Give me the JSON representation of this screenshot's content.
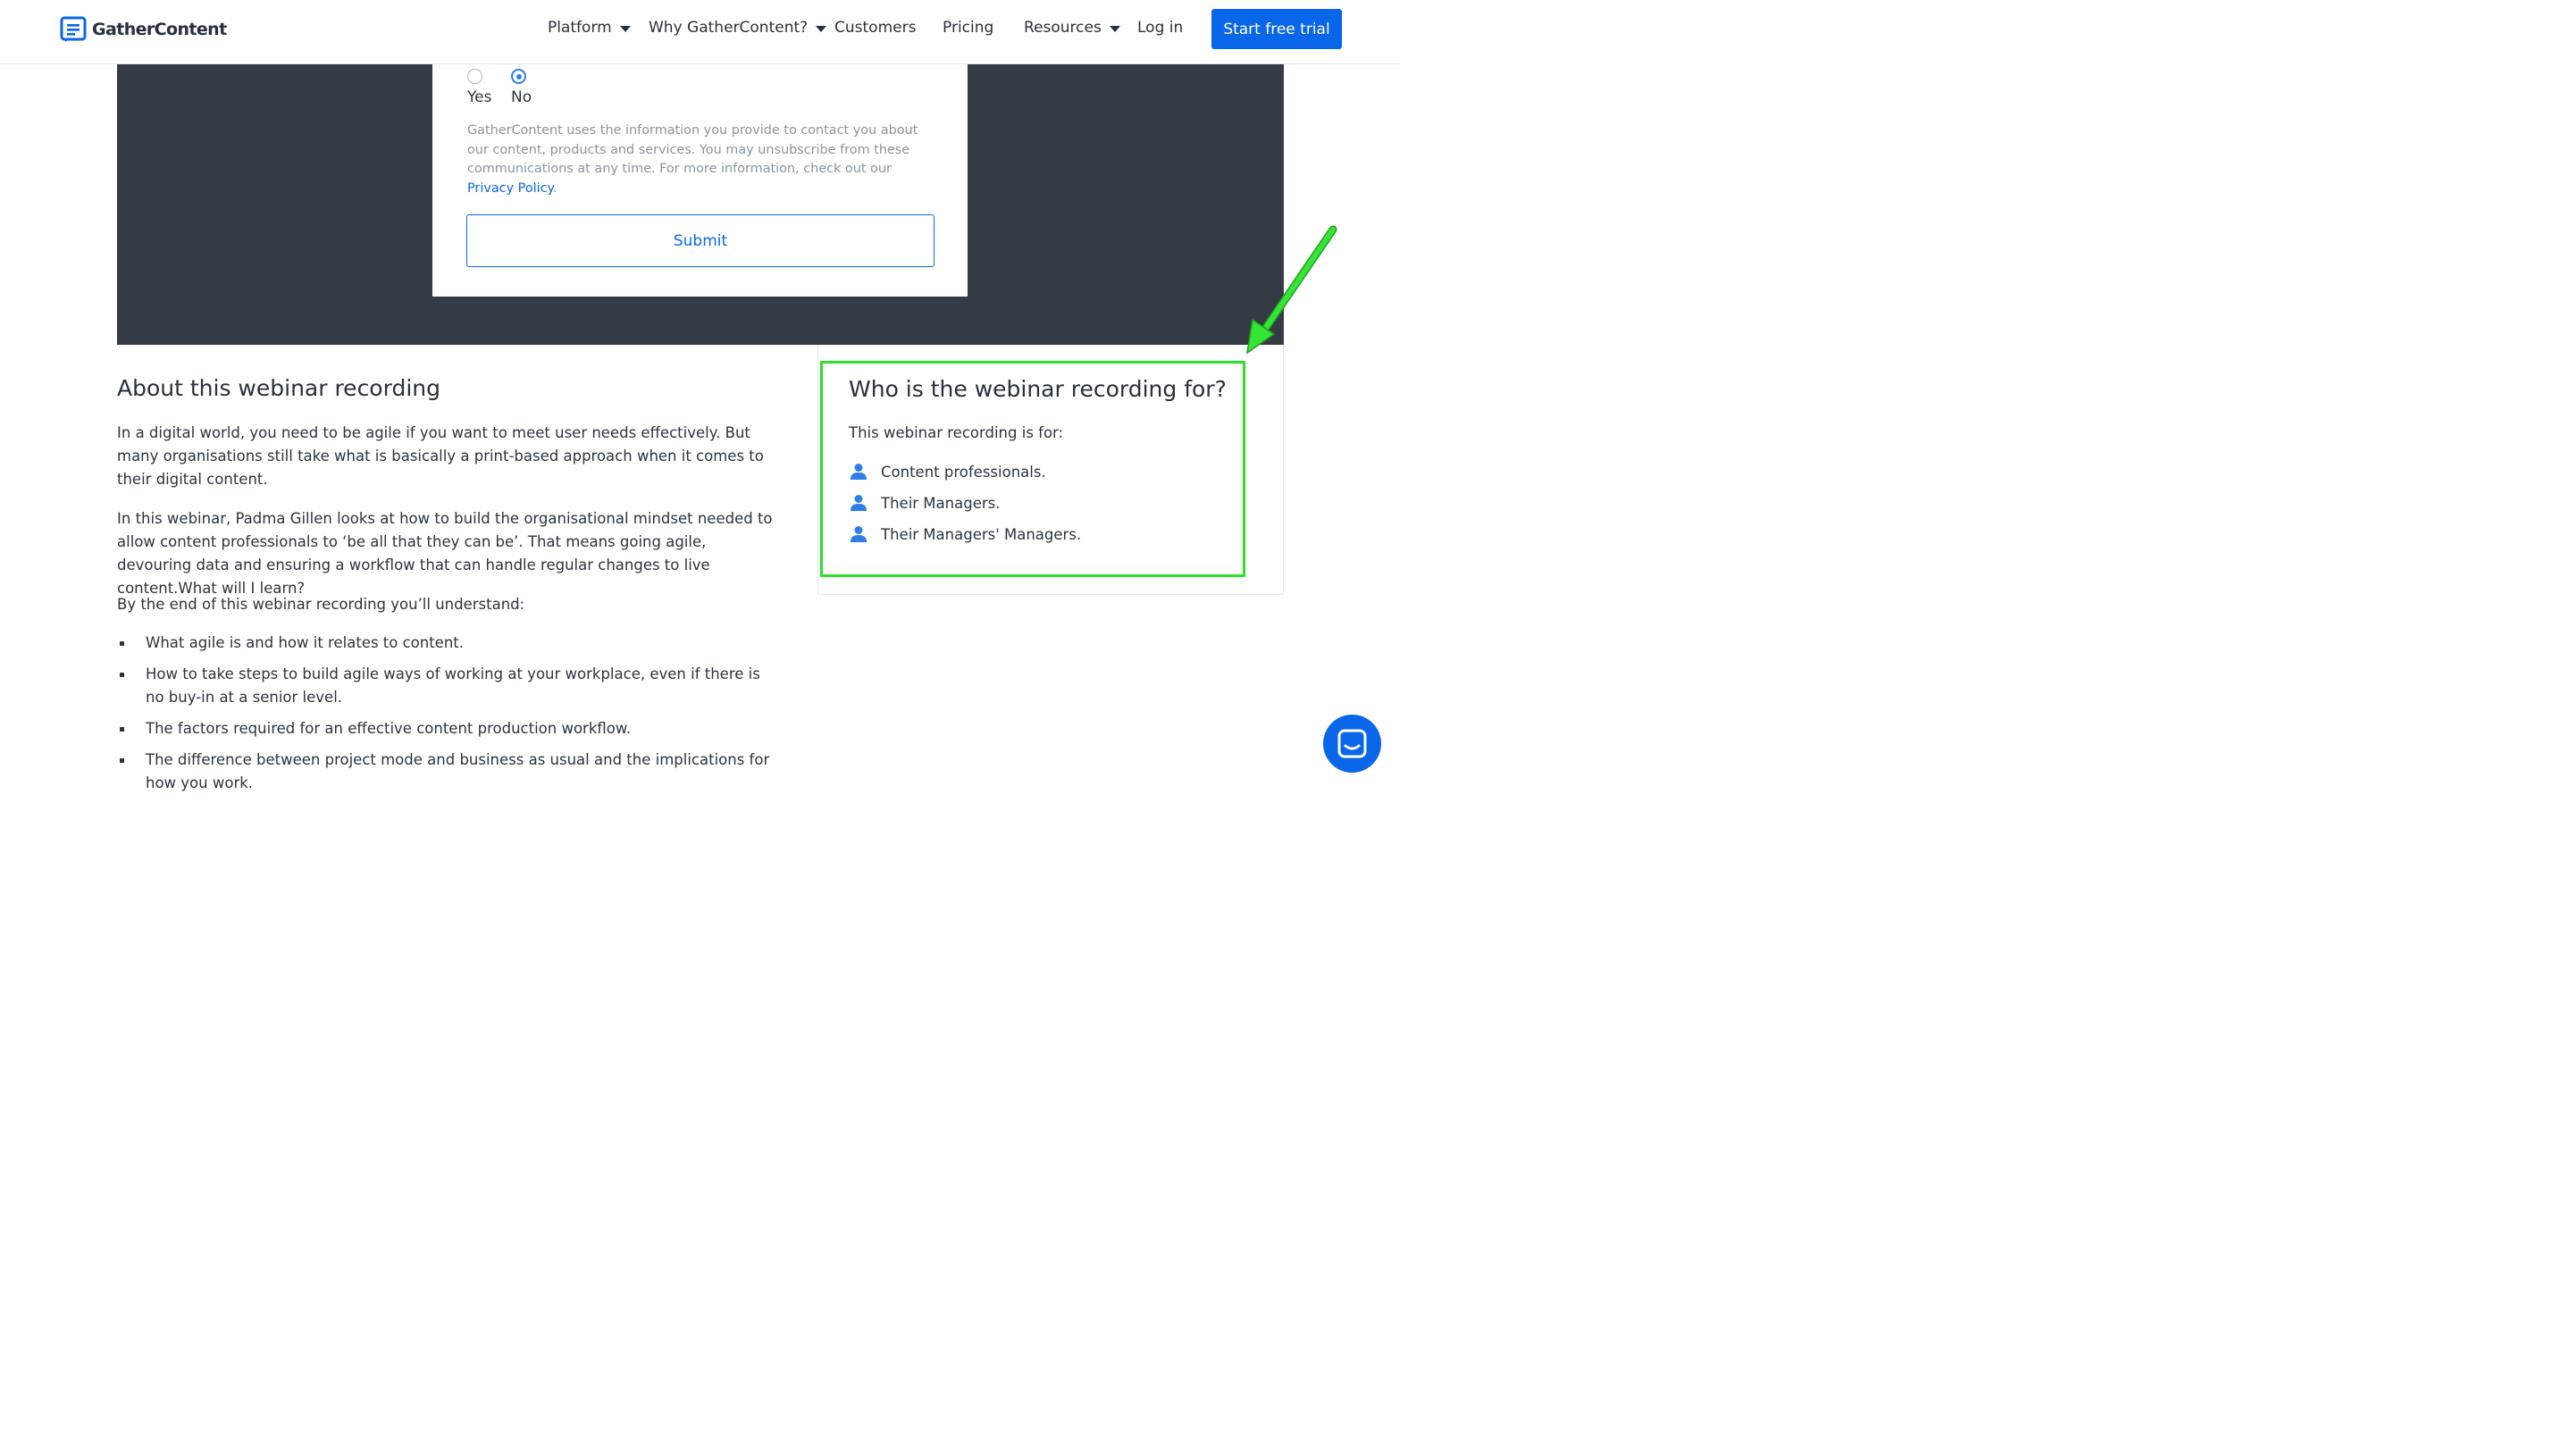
{
  "brand": {
    "name": "GatherContent",
    "accent": "#0a66e8",
    "dark_bg": "#343b44",
    "highlight": "#2de02d"
  },
  "nav": {
    "items": [
      {
        "label": "Platform",
        "has_dropdown": true
      },
      {
        "label": "Why GatherContent?",
        "has_dropdown": true
      },
      {
        "label": "Customers",
        "has_dropdown": false
      },
      {
        "label": "Pricing",
        "has_dropdown": false
      },
      {
        "label": "Resources",
        "has_dropdown": true
      }
    ],
    "login": "Log in",
    "cta": "Start free trial"
  },
  "form": {
    "options": [
      {
        "label": "Yes",
        "selected": false
      },
      {
        "label": "No",
        "selected": true
      }
    ],
    "disclaimer": "GatherContent uses the information you provide to contact you about our content, products and services. You may unsubscribe from these communications at any time. For more information, check out our ",
    "privacy_link": "Privacy Policy",
    "disclaimer_end": ".",
    "submit": "Submit"
  },
  "about": {
    "title": "About this webinar recording",
    "paragraphs": [
      "In a digital world, you need to be agile if you want to meet user needs effectively. But many organisations still take what is basically a print-based approach when it comes to their digital content.",
      "In this webinar, Padma Gillen looks at how to build the organisational mindset needed to allow content professionals to ‘be all that they can be’. That means going agile, devouring data and ensuring a workflow that can handle regular changes to live content.What will I learn?",
      "By the end of this webinar recording you’ll understand:"
    ],
    "bullets": [
      "What agile is and how it relates to content.",
      "How to take steps to build agile ways of working at your workplace, even if there is no buy-in at a senior level.",
      "The factors required for an effective content production workflow.",
      "The difference between project mode and business as usual and the implications for how you work."
    ]
  },
  "audience": {
    "title": "Who is the webinar recording for?",
    "subtitle": "This webinar recording is for:",
    "items": [
      "Content professionals.",
      "Their Managers.",
      "Their Managers' Managers."
    ],
    "icon": "user-icon"
  },
  "chat": {
    "icon": "chat-icon"
  }
}
